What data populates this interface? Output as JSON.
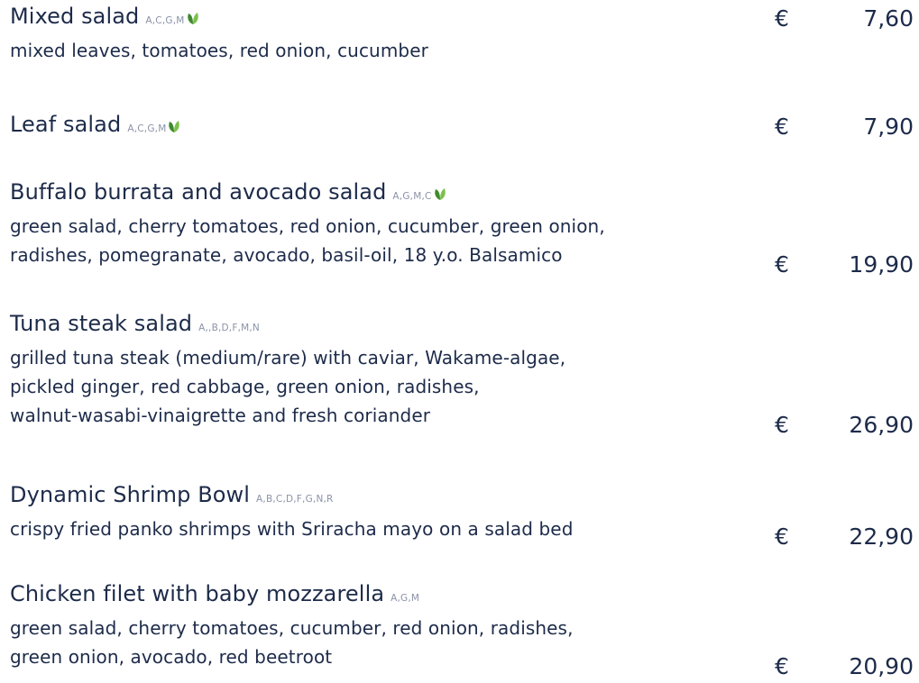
{
  "currency": "€",
  "items": [
    {
      "title": "Mixed salad",
      "allergens": "A,C,G,M",
      "vegetarian": true,
      "lines": [
        "mixed leaves, tomatoes, red onion, cucumber"
      ],
      "price": "7,60"
    },
    {
      "title": "Leaf salad",
      "allergens": "A,C,G,M",
      "vegetarian": true,
      "lines": [],
      "price": "7,90"
    },
    {
      "title": "Buffalo burrata and avocado salad",
      "allergens": "A,G,M,C",
      "vegetarian": true,
      "lines": [
        "green salad, cherry tomatoes, red onion, cucumber, green onion,",
        "radishes, pomegranate, avocado, basil-oil, 18 y.o. Balsamico"
      ],
      "price": "19,90"
    },
    {
      "title": "Tuna steak salad",
      "allergens": "A,,B,D,F,M,N",
      "vegetarian": false,
      "lines": [
        "grilled tuna steak (medium/rare) with caviar, Wakame-algae,",
        "pickled ginger, red cabbage, green onion, radishes,",
        "walnut-wasabi-vinaigrette and fresh coriander"
      ],
      "price": "26,90"
    },
    {
      "title": "Dynamic Shrimp Bowl",
      "allergens": "A,B,C,D,F,G,N,R",
      "vegetarian": false,
      "lines": [
        "crispy fried panko shrimps with Sriracha mayo on a salad bed"
      ],
      "price": "22,90"
    },
    {
      "title": "Chicken filet with baby mozzarella",
      "allergens": "A,G,M",
      "vegetarian": false,
      "lines": [
        "green salad, cherry tomatoes, cucumber, red onion, radishes,",
        "green onion, avocado, red beetroot"
      ],
      "price": "20,90"
    }
  ],
  "leaf_icon": "leaf-icon",
  "colors": {
    "text": "#1d2b4a",
    "allergens": "#8a93a8",
    "leaf_dark": "#3f8a2f",
    "leaf_light": "#7cc04a"
  }
}
